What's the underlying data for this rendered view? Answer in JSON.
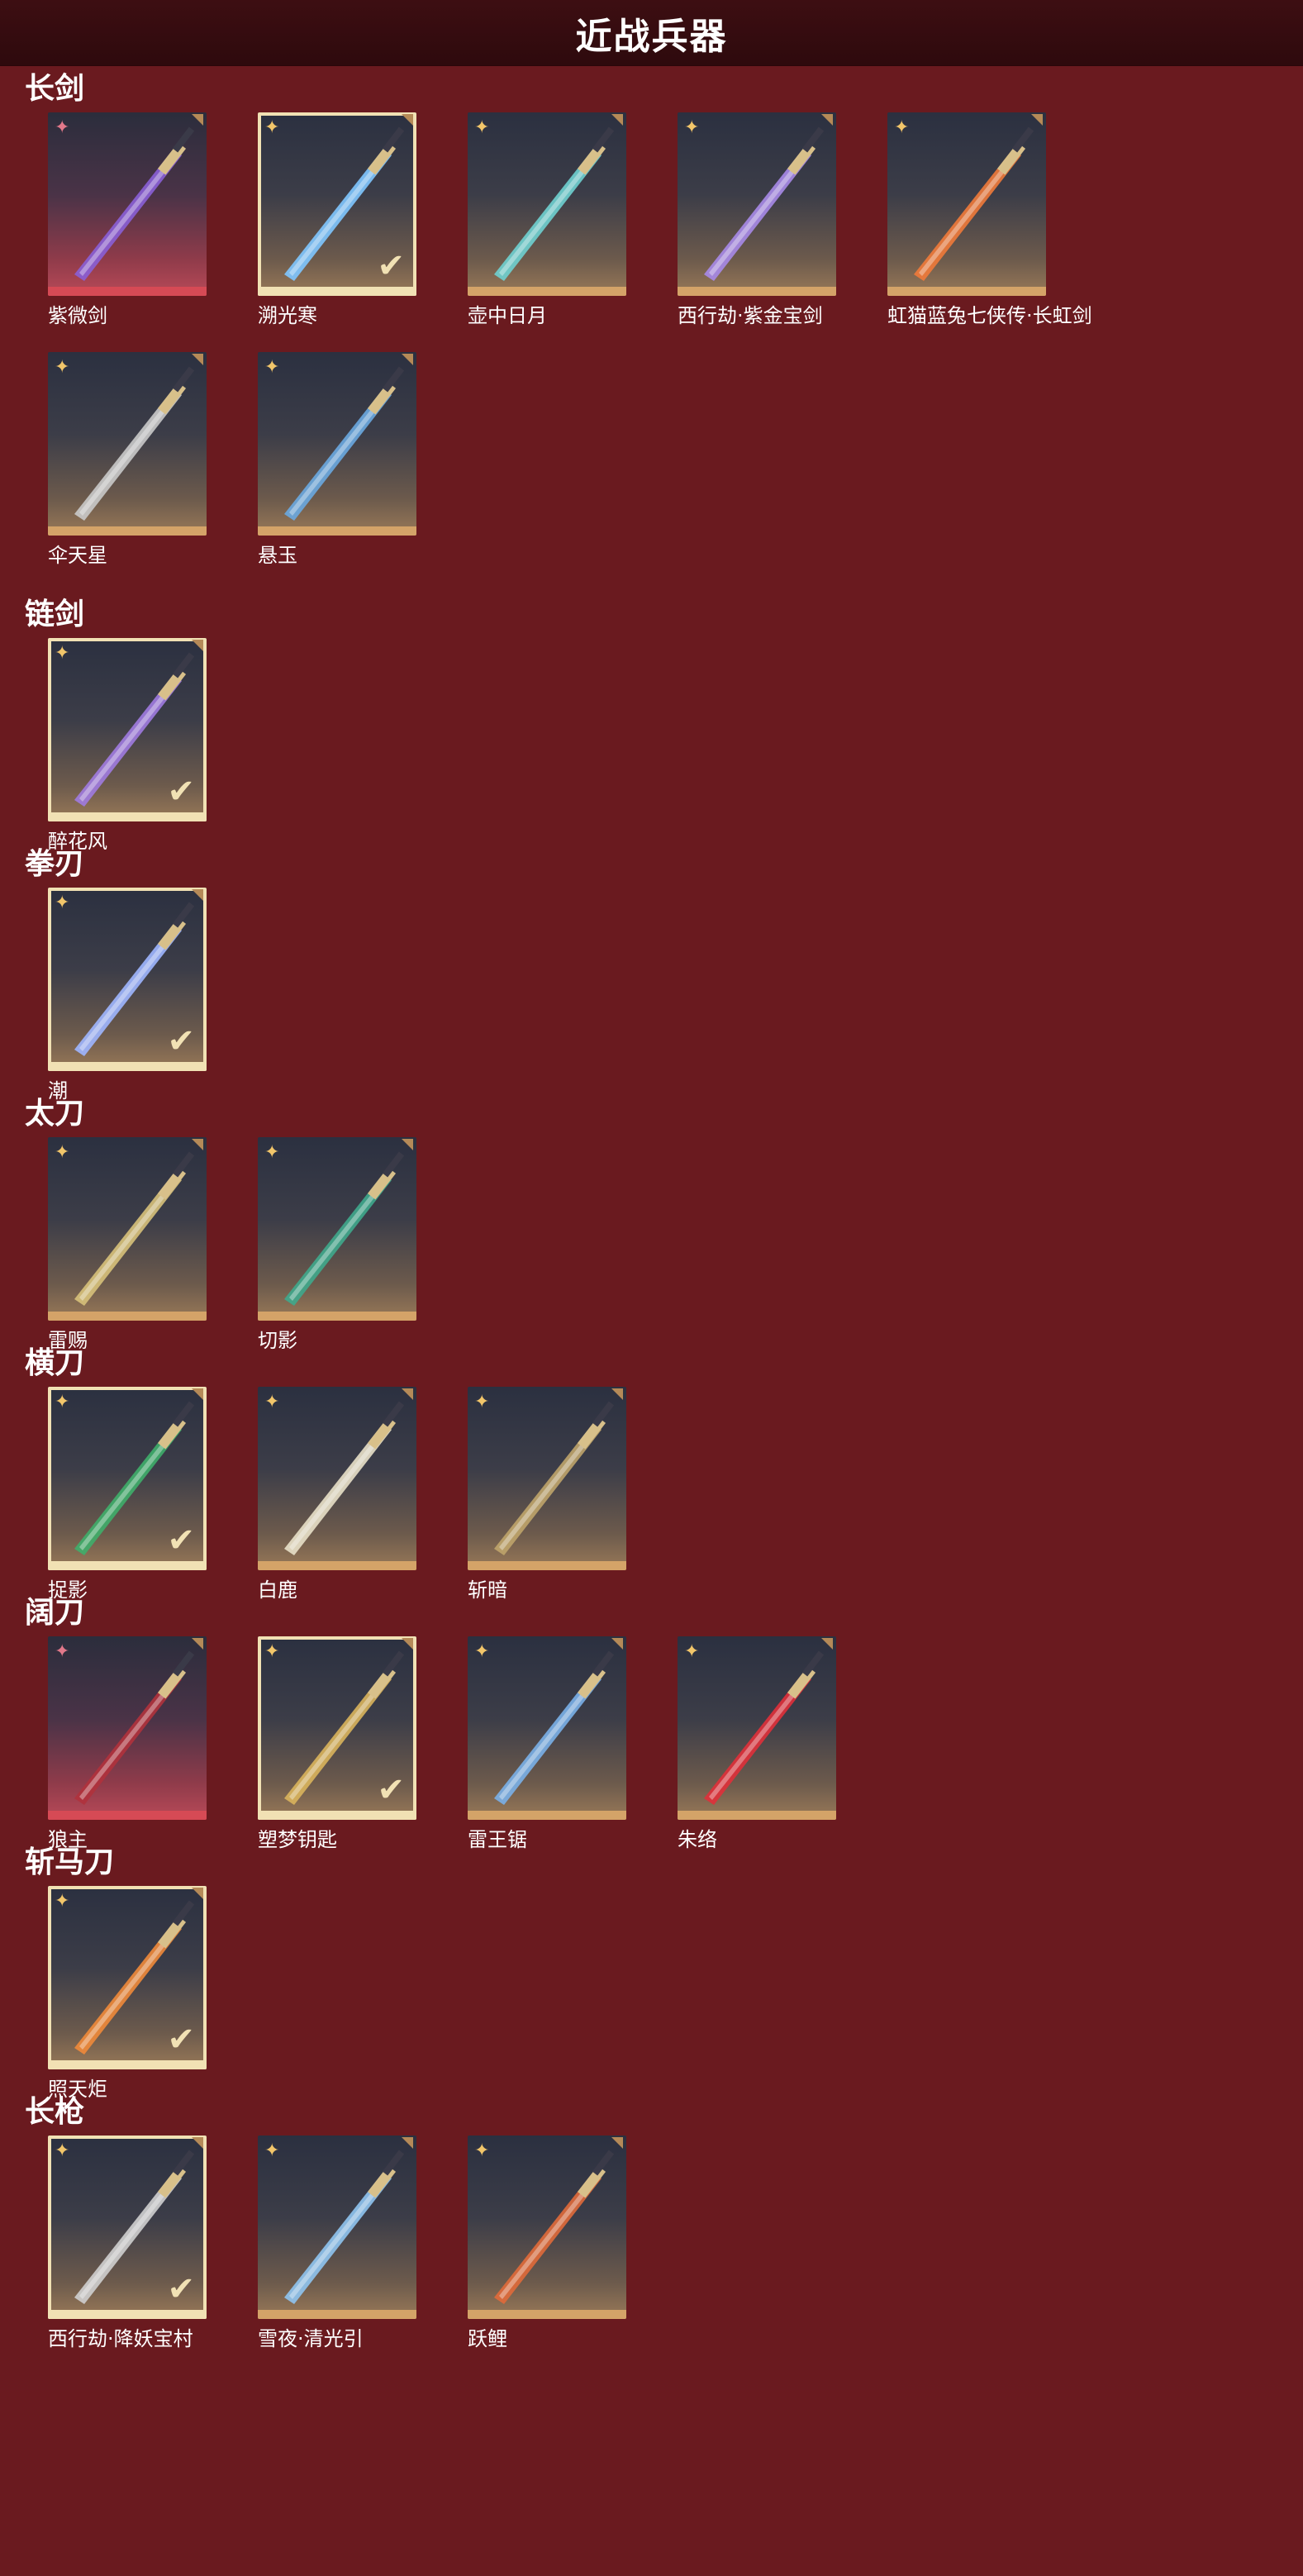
{
  "header": {
    "title": "近战兵器"
  },
  "categories": [
    {
      "title": "长剑",
      "items": [
        {
          "name": "紫微剑",
          "rarity": "pink",
          "selected": false,
          "color": "#8a5fd6"
        },
        {
          "name": "溯光寒",
          "rarity": "gold",
          "selected": true,
          "color": "#7fc6ff"
        },
        {
          "name": "壶中日月",
          "rarity": "gold",
          "selected": false,
          "color": "#6fd0d0"
        },
        {
          "name": "西行劫·紫金宝剑",
          "rarity": "gold",
          "selected": false,
          "color": "#a78ae8"
        },
        {
          "name": "虹猫蓝兔七侠传·长虹剑",
          "rarity": "gold",
          "selected": false,
          "color": "#f07a3a"
        },
        {
          "name": "伞天星",
          "rarity": "gold",
          "selected": false,
          "color": "#c9c9c9"
        },
        {
          "name": "悬玉",
          "rarity": "gold",
          "selected": false,
          "color": "#6aa8e0"
        }
      ]
    },
    {
      "title": "链剑",
      "items": [
        {
          "name": "醉花风",
          "rarity": "gold",
          "selected": true,
          "color": "#a07be0"
        }
      ]
    },
    {
      "title": "拳刃",
      "items": [
        {
          "name": "潮",
          "rarity": "gold",
          "selected": true,
          "color": "#9fb6ff"
        }
      ]
    },
    {
      "title": "太刀",
      "items": [
        {
          "name": "雷赐",
          "rarity": "gold",
          "selected": false,
          "color": "#d7c17a"
        },
        {
          "name": "切影",
          "rarity": "gold",
          "selected": false,
          "color": "#3fa88c"
        }
      ]
    },
    {
      "title": "横刀",
      "items": [
        {
          "name": "捉影",
          "rarity": "gold",
          "selected": true,
          "color": "#3fae6a"
        },
        {
          "name": "白鹿",
          "rarity": "gold",
          "selected": false,
          "color": "#e8e0c8"
        },
        {
          "name": "斩暗",
          "rarity": "gold",
          "selected": false,
          "color": "#bfa46a"
        }
      ]
    },
    {
      "title": "阔刀",
      "items": [
        {
          "name": "狼主",
          "rarity": "pink",
          "selected": false,
          "color": "#b0323c"
        },
        {
          "name": "塑梦钥匙",
          "rarity": "gold",
          "selected": true,
          "color": "#d9b45c"
        },
        {
          "name": "雷王锯",
          "rarity": "gold",
          "selected": false,
          "color": "#7ab0e8"
        },
        {
          "name": "朱络",
          "rarity": "gold",
          "selected": false,
          "color": "#e0303a"
        }
      ]
    },
    {
      "title": "斩马刀",
      "items": [
        {
          "name": "照天炬",
          "rarity": "gold",
          "selected": true,
          "color": "#f08a3a"
        }
      ]
    },
    {
      "title": "长枪",
      "items": [
        {
          "name": "西行劫·降妖宝村",
          "rarity": "gold",
          "selected": true,
          "color": "#cfcfcf"
        },
        {
          "name": "雪夜·清光引",
          "rarity": "gold",
          "selected": false,
          "color": "#8fc4f0"
        },
        {
          "name": "跃鲤",
          "rarity": "gold",
          "selected": false,
          "color": "#e06a3a"
        }
      ]
    }
  ]
}
